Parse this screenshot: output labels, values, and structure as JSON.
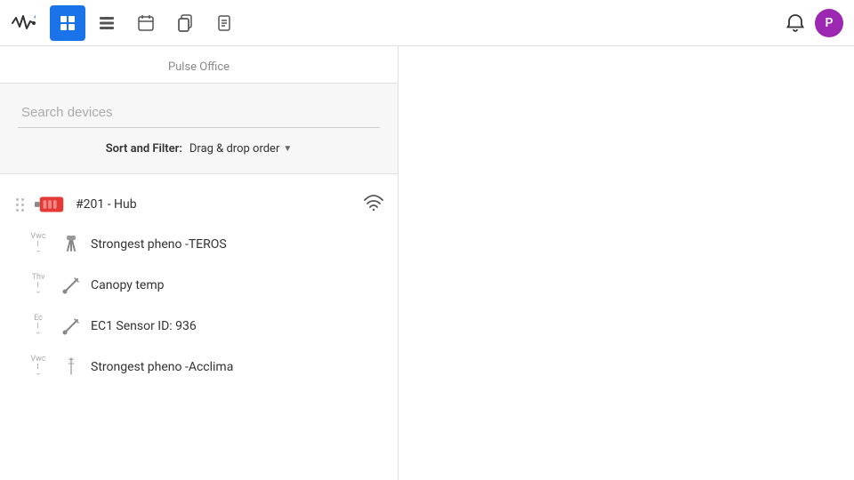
{
  "app": {
    "title": "Pulse Office"
  },
  "navbar": {
    "logo_label": "Pulse",
    "nav_items": [
      {
        "id": "dashboard",
        "label": "Dashboard",
        "active": true
      },
      {
        "id": "grid",
        "label": "Grid",
        "active": false
      },
      {
        "id": "calendar",
        "label": "Calendar",
        "active": false
      },
      {
        "id": "copy",
        "label": "Copy",
        "active": false
      },
      {
        "id": "document",
        "label": "Document",
        "active": false
      }
    ],
    "bell_label": "Notifications",
    "avatar_label": "P"
  },
  "panel": {
    "header": "Pulse Office",
    "search_placeholder": "Search devices",
    "sort_filter_label": "Sort and Filter:",
    "sort_filter_value": "Drag & drop order"
  },
  "devices": [
    {
      "id": "hub-201",
      "label": "#201 - Hub",
      "type": "hub",
      "has_wifi": true,
      "sensors": [
        {
          "type_tag": "Vwc",
          "name": "Strongest pheno -TEROS"
        },
        {
          "type_tag": "Thv",
          "name": "Canopy temp"
        },
        {
          "type_tag": "Ec",
          "name": "EC1 Sensor ID: 936"
        },
        {
          "type_tag": "Vwc",
          "name": "Strongest pheno -Acclima"
        }
      ]
    }
  ]
}
